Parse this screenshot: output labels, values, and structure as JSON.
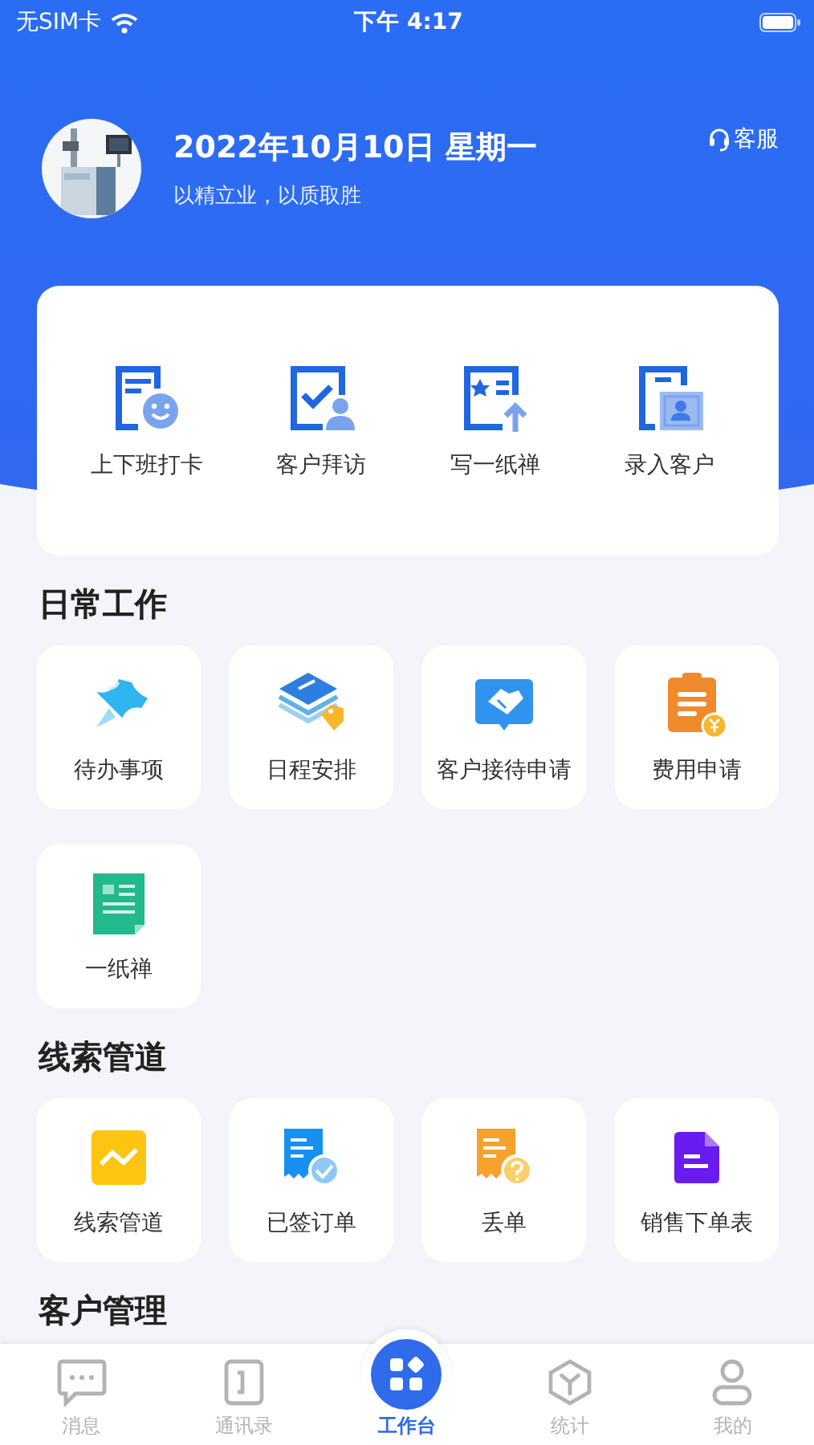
{
  "status_bar": {
    "carrier": "无SIM卡",
    "time": "下午 4:17"
  },
  "header": {
    "date": "2022年10月10日 星期一",
    "slogan": "以精立业，以质取胜",
    "service": "客服"
  },
  "quick_actions": [
    {
      "label": "上下班打卡"
    },
    {
      "label": "客户拜访"
    },
    {
      "label": "写一纸禅"
    },
    {
      "label": "录入客户"
    }
  ],
  "sections": [
    {
      "title": "日常工作",
      "items": [
        {
          "label": "待办事项"
        },
        {
          "label": "日程安排"
        },
        {
          "label": "客户接待申请"
        },
        {
          "label": "费用申请"
        },
        {
          "label": "一纸禅"
        }
      ]
    },
    {
      "title": "线索管道",
      "items": [
        {
          "label": "线索管道"
        },
        {
          "label": "已签订单"
        },
        {
          "label": "丢单"
        },
        {
          "label": "销售下单表"
        }
      ]
    },
    {
      "title": "客户管理"
    }
  ],
  "tab_bar": [
    {
      "label": "消息",
      "selected": false
    },
    {
      "label": "通讯录",
      "selected": false
    },
    {
      "label": "工作台",
      "selected": true
    },
    {
      "label": "统计",
      "selected": false
    },
    {
      "label": "我的",
      "selected": false
    }
  ]
}
